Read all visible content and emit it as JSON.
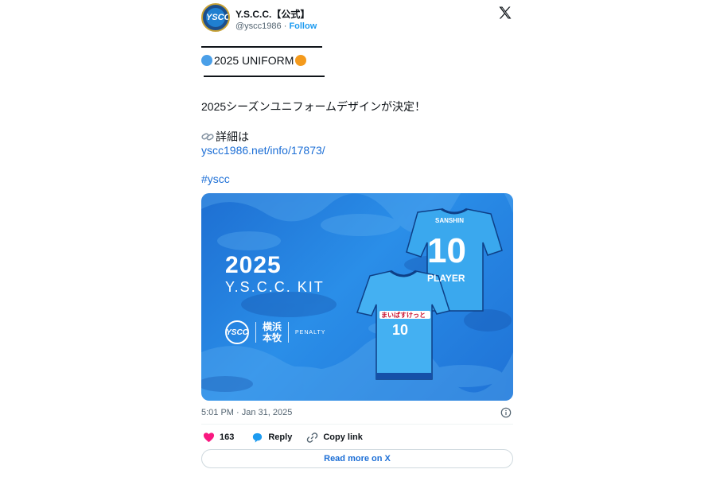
{
  "header": {
    "author_name": "Y.S.C.C.【公式】",
    "handle": "@yscc1986",
    "separator": "·",
    "follow_label": "Follow",
    "avatar_text": "YSCC"
  },
  "tweet": {
    "headline": "2025 UNIFORM",
    "headline_colors": {
      "left_dot": "#4a9fe8",
      "right_dot": "#f49a1c"
    },
    "announcement": "2025シーズンユニフォームデザインが決定！",
    "details_label": "詳細は",
    "details_link": "yscc1986.net/info/17873/",
    "hashtag": "#yscc"
  },
  "media": {
    "year": "2025",
    "kit_title": "Y.S.C.C. KIT",
    "badge_text": "YSCC",
    "kanji_top": "横浜",
    "kanji_bottom": "本牧",
    "brand": "PENALTY",
    "back_jersey_number": "10",
    "back_jersey_name": "PLAYER",
    "back_jersey_sponsor": "SANSHIN",
    "front_jersey_number": "10",
    "front_jersey_sponsor": "まいばすけっと"
  },
  "footer": {
    "timestamp": "5:01 PM · Jan 31, 2025",
    "like_count": "163",
    "reply_label": "Reply",
    "copy_link_label": "Copy link",
    "read_more_label": "Read more on X"
  },
  "colors": {
    "accent": "#1d9bf0",
    "link": "#1d6fd6",
    "like": "#f91880",
    "text": "#0f1419",
    "muted": "#536471"
  }
}
